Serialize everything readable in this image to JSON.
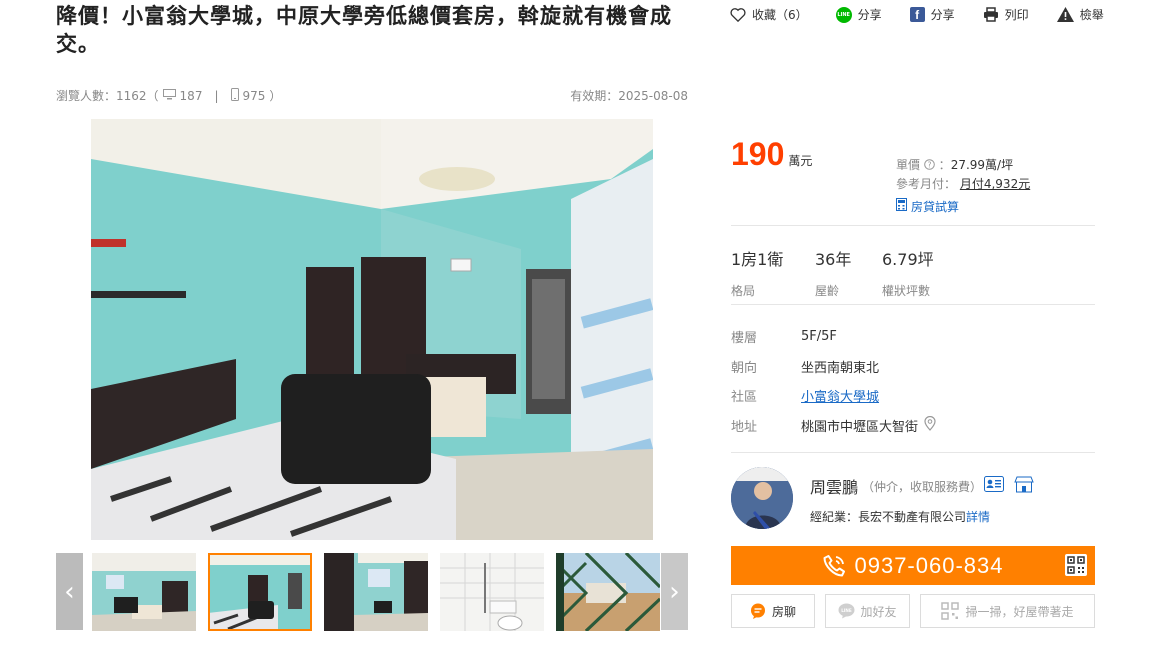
{
  "listing": {
    "title": "降價！小富翁大學城，中原大學旁低總價套房，斡旋就有機會成交。",
    "actions": {
      "favorite_label": "收藏（6）",
      "line_share_label": "分享",
      "fb_share_label": "分享",
      "print_label": "列印",
      "report_label": "檢舉"
    },
    "stats": {
      "views_label": "瀏覽人數：1162（",
      "desktop_views": "187",
      "separator": "|",
      "mobile_views": "975",
      "close_paren": "）",
      "valid_until": "有效期：2025-08-08"
    }
  },
  "gallery": {
    "thumbnails": [
      {
        "alt": "living-room"
      },
      {
        "alt": "bedroom-wide"
      },
      {
        "alt": "bedroom-door"
      },
      {
        "alt": "bathroom"
      },
      {
        "alt": "balcony"
      }
    ],
    "active_index": 1
  },
  "price": {
    "amount": "190",
    "unit": "萬元",
    "unit_price_label": "單價",
    "unit_price": "27.99萬/坪",
    "monthly_label": "參考月付：",
    "monthly": "月付4,932元",
    "loan_calc": "房貸試算"
  },
  "specs": [
    {
      "value": "1房1衛",
      "label": "格局"
    },
    {
      "value": "36年",
      "label": "屋齡"
    },
    {
      "value": "6.79坪",
      "label": "權狀坪數"
    }
  ],
  "details": {
    "floor_label": "樓層",
    "floor": "5F/5F",
    "facing_label": "朝向",
    "facing": "坐西南朝東北",
    "community_label": "社區",
    "community": "小富翁大學城",
    "address_label": "地址",
    "address": "桃園市中壢區大智街"
  },
  "agent": {
    "name": "周雲鵬",
    "role": "（仲介，收取服務費）",
    "company_label": "經紀業：長宏不動產有限公司",
    "company_link": "詳情"
  },
  "contact": {
    "phone": "0937-060-834",
    "chat_label": "房聊",
    "add_friend_label": "加好友",
    "scan_label": "掃一掃，好屋帶著走"
  },
  "colors": {
    "accent": "#ff8000",
    "price": "#ff3f00",
    "link": "#1a6ac6"
  }
}
